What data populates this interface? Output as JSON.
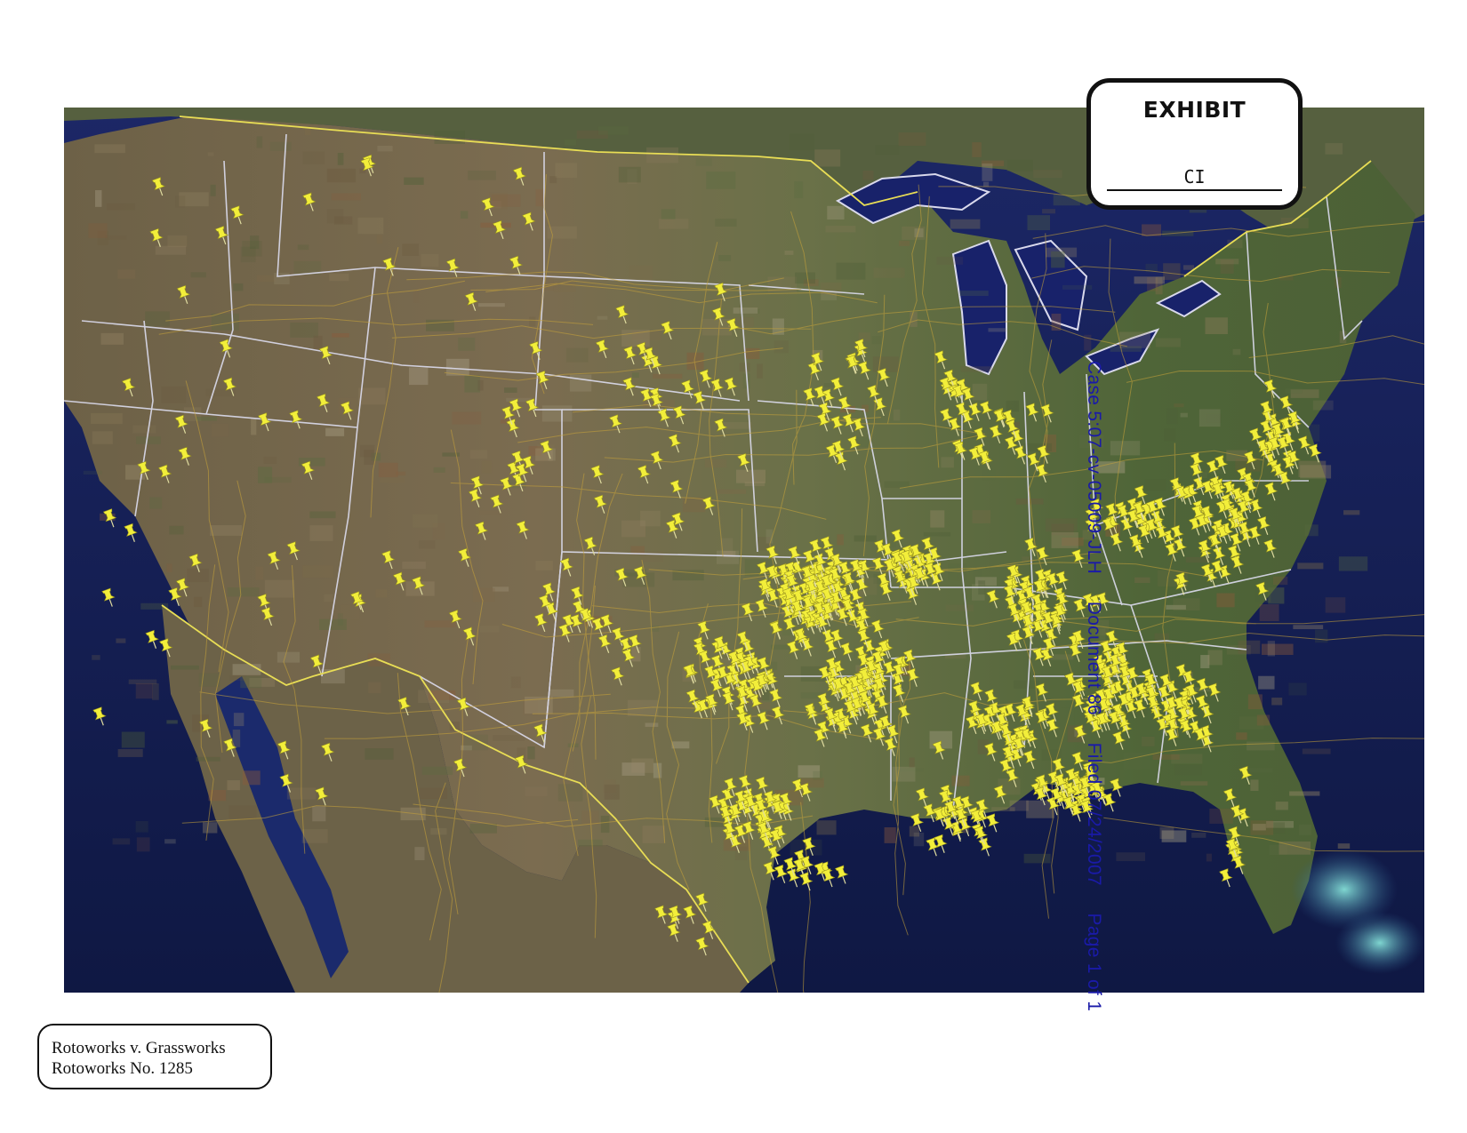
{
  "exhibit": {
    "title": "EXHIBIT",
    "number": "CI"
  },
  "caption": {
    "line1": "Rotoworks v. Grassworks",
    "line2": "Rotoworks No. 1285"
  },
  "file_stamp": "Case 5:07-cv-05009-JLH     Document 86     Filed 07/24/2007     Page 1 of 1",
  "map": {
    "style": "satellite imagery of the contiguous United States with state borders and road overlay",
    "marker_icon": "pushpin-icon",
    "colors": {
      "ocean": "#141d52",
      "land": "#5e6a47",
      "border": "#d9d9ec",
      "roads": "#c9a43a",
      "pushpin": "#f2ee3a"
    }
  }
}
